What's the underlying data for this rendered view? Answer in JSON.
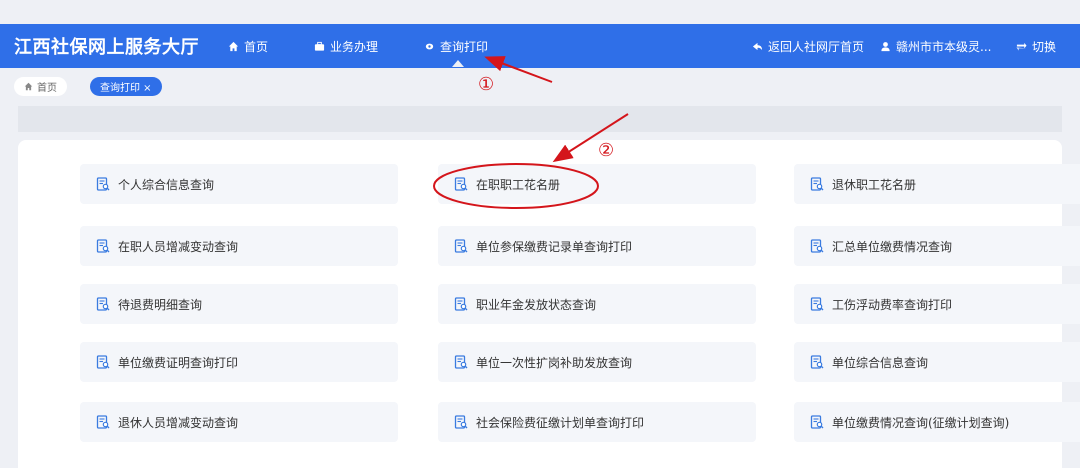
{
  "header": {
    "brand": "江西社保网上服务大厅",
    "nav": [
      {
        "label": "首页"
      },
      {
        "label": "业务办理"
      },
      {
        "label": "查询打印"
      }
    ],
    "right": [
      {
        "label": "返回人社网厅首页"
      },
      {
        "label": "赣州市市本级灵..."
      },
      {
        "label": "切换"
      }
    ]
  },
  "tabs": {
    "home": "首页",
    "active": "查询打印 ×"
  },
  "cards": [
    "个人综合信息查询",
    "在职职工花名册",
    "退休职工花名册",
    "在职人员增减变动查询",
    "单位参保缴费记录单查询打印",
    "汇总单位缴费情况查询",
    "待退费明细查询",
    "职业年金发放状态查询",
    "工伤浮动费率查询打印",
    "单位缴费证明查询打印",
    "单位一次性扩岗补助发放查询",
    "单位综合信息查询",
    "退休人员增减变动查询",
    "社会保险费征缴计划单查询打印",
    "单位缴费情况查询(征缴计划查询)"
  ],
  "annotations": {
    "marker1": "①",
    "marker2": "②"
  },
  "colors": {
    "header_bg": "#2f6fe8",
    "annotation": "#d4151b",
    "card_icon": "#3a7be0"
  }
}
